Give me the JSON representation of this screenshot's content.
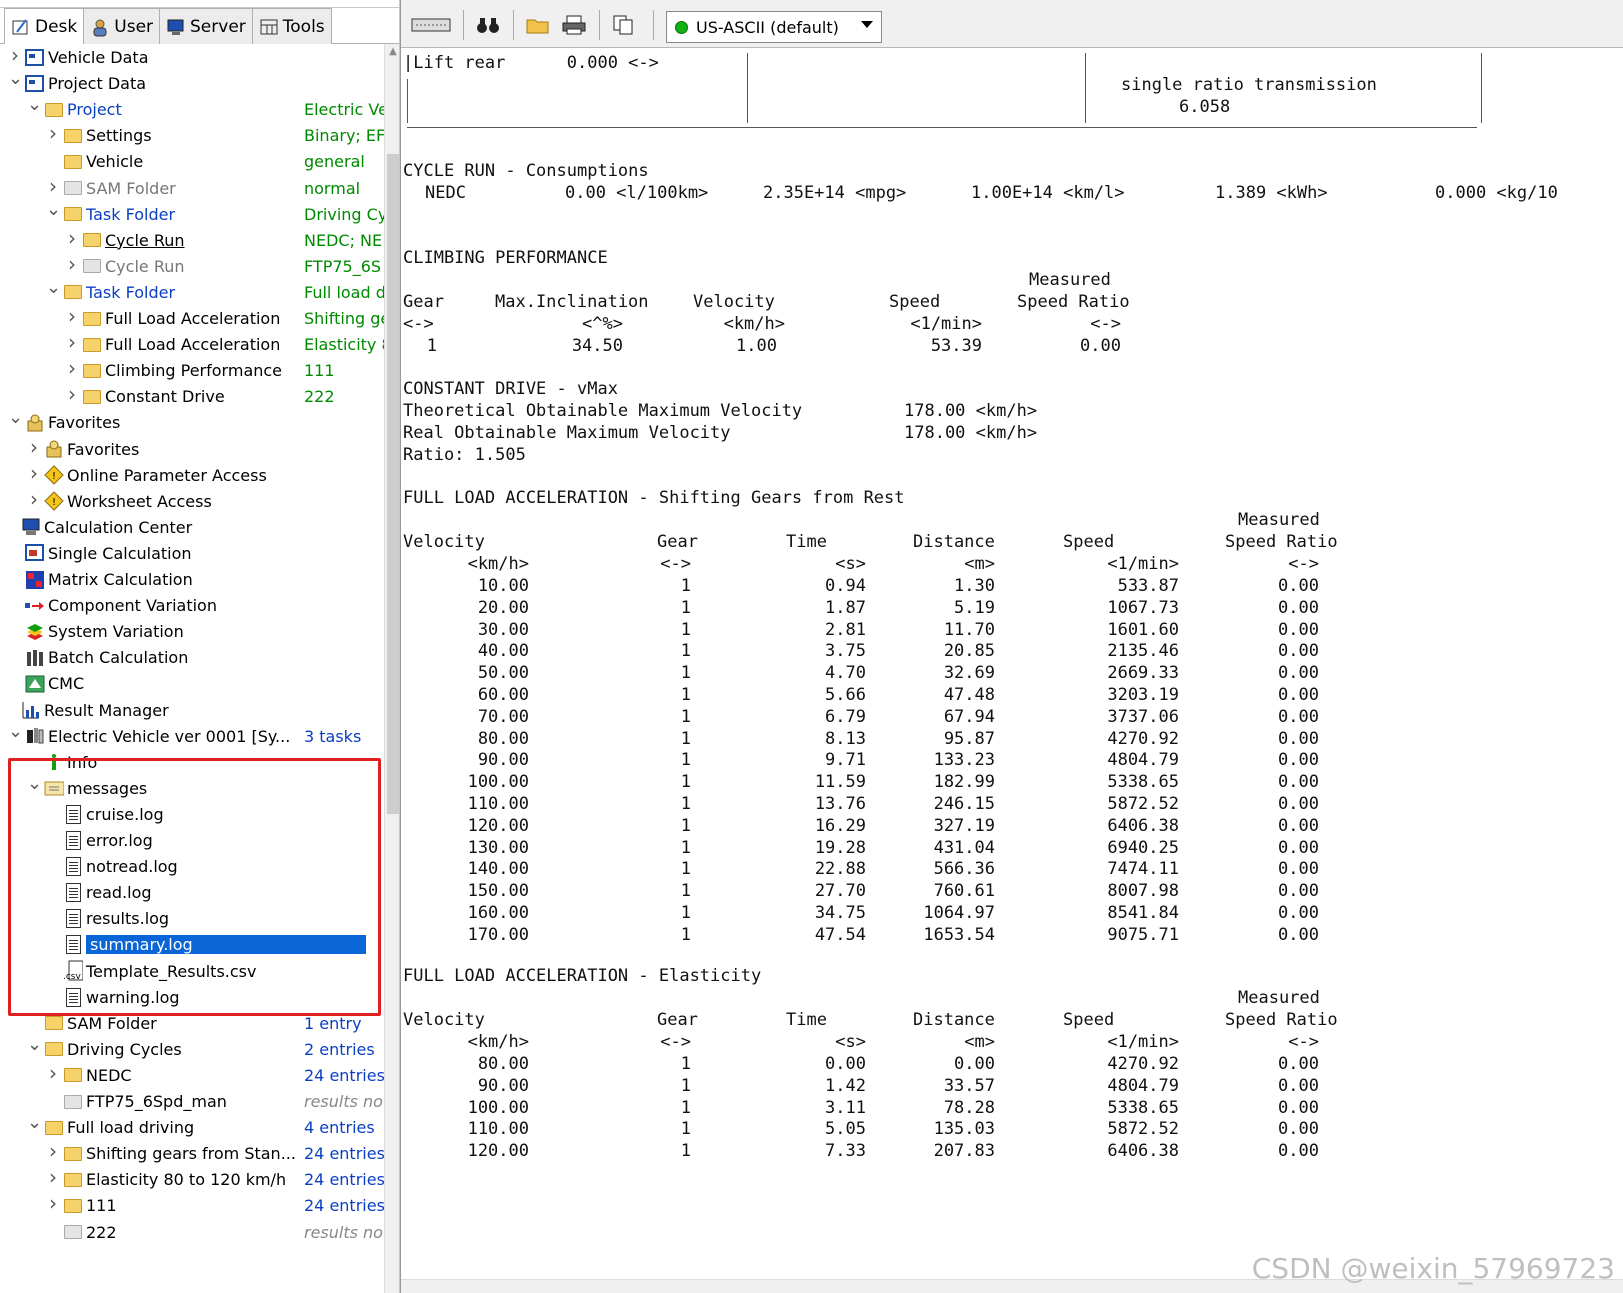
{
  "tabs": [
    "Desk",
    "User",
    "Server",
    "Tools"
  ],
  "tree": [
    {
      "label": "Vehicle Data",
      "value": ""
    },
    {
      "label": "Project Data",
      "value": ""
    },
    {
      "label": "Project",
      "value": "Electric Vel"
    },
    {
      "label": "Settings",
      "value": "Binary; EF"
    },
    {
      "label": "Vehicle",
      "value": "general"
    },
    {
      "label": "SAM Folder",
      "value": "normal"
    },
    {
      "label": "Task Folder",
      "value": "Driving Cy"
    },
    {
      "label": "Cycle Run",
      "value": "NEDC; NE"
    },
    {
      "label": "Cycle Run",
      "value": "FTP75_6S"
    },
    {
      "label": "Task Folder",
      "value": "Full load dr"
    },
    {
      "label": "Full Load Acceleration",
      "value": "Shifting ge"
    },
    {
      "label": "Full Load Acceleration",
      "value": "Elasticity 8"
    },
    {
      "label": "Climbing Performance",
      "value": "111"
    },
    {
      "label": "Constant Drive",
      "value": "222"
    },
    {
      "label": "Favorites",
      "value": ""
    },
    {
      "label": "Favorites",
      "value": ""
    },
    {
      "label": "Online Parameter Access",
      "value": ""
    },
    {
      "label": "Worksheet Access",
      "value": ""
    },
    {
      "label": "Calculation Center",
      "value": ""
    },
    {
      "label": "Single Calculation",
      "value": ""
    },
    {
      "label": "Matrix Calculation",
      "value": ""
    },
    {
      "label": "Component Variation",
      "value": ""
    },
    {
      "label": "System Variation",
      "value": ""
    },
    {
      "label": "Batch Calculation",
      "value": ""
    },
    {
      "label": "CMC",
      "value": ""
    },
    {
      "label": "Result Manager",
      "value": ""
    },
    {
      "label": "Electric Vehicle ver 0001 [Sy...",
      "value": "3 tasks"
    },
    {
      "label": "Info",
      "value": ""
    },
    {
      "label": "messages",
      "value": ""
    },
    {
      "label": "cruise.log",
      "value": ""
    },
    {
      "label": "error.log",
      "value": ""
    },
    {
      "label": "notread.log",
      "value": ""
    },
    {
      "label": "read.log",
      "value": ""
    },
    {
      "label": "results.log",
      "value": ""
    },
    {
      "label": "summary.log",
      "value": ""
    },
    {
      "label": "Template_Results.csv",
      "value": ""
    },
    {
      "label": "warning.log",
      "value": ""
    },
    {
      "label": "SAM Folder",
      "value": "1 entry"
    },
    {
      "label": "Driving Cycles",
      "value": "2 entries"
    },
    {
      "label": "NEDC",
      "value": "24 entries"
    },
    {
      "label": "FTP75_6Spd_man",
      "value": "results not"
    },
    {
      "label": "Full load driving",
      "value": "4 entries"
    },
    {
      "label": "Shifting gears from Stan...",
      "value": "24 entries"
    },
    {
      "label": "Elasticity 80 to 120 km/h",
      "value": "24 entries"
    },
    {
      "label": "111",
      "value": "24 entries"
    },
    {
      "label": "222",
      "value": "results not"
    }
  ],
  "toolbar": {
    "encoding": "US-ASCII (default)"
  },
  "report": {
    "header_box": {
      "lift_rear": "|Lift rear      0.000 <->",
      "transmission": "single ratio transmission",
      "ratio": "6.058"
    },
    "cycle_run": {
      "title": "CYCLE RUN - Consumptions",
      "cycle": "NEDC",
      "v1": "0.00 <l/100km>",
      "v2": "2.35E+14 <mpg>",
      "v3": "1.00E+14 <km/l>",
      "v4": "1.389 <kWh>",
      "v5": "0.000 <kg/10"
    },
    "climbing": {
      "title": "CLIMBING PERFORMANCE",
      "measured": "Measured",
      "headers": [
        "Gear",
        "Max.Inclination",
        "Velocity",
        "Speed",
        "Speed Ratio"
      ],
      "units": [
        "<->",
        "<^%>",
        "<km/h>",
        "<1/min>",
        "<->"
      ],
      "row": [
        "1",
        "34.50",
        "1.00",
        "53.39",
        "0.00"
      ]
    },
    "constant": {
      "title": "CONSTANT DRIVE - vMax",
      "line1_label": "Theoretical Obtainable Maximum Velocity",
      "line1_value": "178.00 <km/h>",
      "line2_label": "Real Obtainable Maximum Velocity",
      "line2_value": "178.00 <km/h>",
      "ratio": "Ratio: 1.505"
    },
    "fla1": {
      "title": "FULL LOAD ACCELERATION - Shifting Gears from Rest",
      "measured": "Measured",
      "headers": [
        "Velocity",
        "Gear",
        "Time",
        "Distance",
        "Speed",
        "Speed Ratio"
      ],
      "units": [
        "<km/h>",
        "<->",
        "<s>",
        "<m>",
        "<1/min>",
        "<->"
      ],
      "rows": [
        [
          "10.00",
          "1",
          "0.94",
          "1.30",
          "533.87",
          "0.00"
        ],
        [
          "20.00",
          "1",
          "1.87",
          "5.19",
          "1067.73",
          "0.00"
        ],
        [
          "30.00",
          "1",
          "2.81",
          "11.70",
          "1601.60",
          "0.00"
        ],
        [
          "40.00",
          "1",
          "3.75",
          "20.85",
          "2135.46",
          "0.00"
        ],
        [
          "50.00",
          "1",
          "4.70",
          "32.69",
          "2669.33",
          "0.00"
        ],
        [
          "60.00",
          "1",
          "5.66",
          "47.48",
          "3203.19",
          "0.00"
        ],
        [
          "70.00",
          "1",
          "6.79",
          "67.94",
          "3737.06",
          "0.00"
        ],
        [
          "80.00",
          "1",
          "8.13",
          "95.87",
          "4270.92",
          "0.00"
        ],
        [
          "90.00",
          "1",
          "9.71",
          "133.23",
          "4804.79",
          "0.00"
        ],
        [
          "100.00",
          "1",
          "11.59",
          "182.99",
          "5338.65",
          "0.00"
        ],
        [
          "110.00",
          "1",
          "13.76",
          "246.15",
          "5872.52",
          "0.00"
        ],
        [
          "120.00",
          "1",
          "16.29",
          "327.19",
          "6406.38",
          "0.00"
        ],
        [
          "130.00",
          "1",
          "19.28",
          "431.04",
          "6940.25",
          "0.00"
        ],
        [
          "140.00",
          "1",
          "22.88",
          "566.36",
          "7474.11",
          "0.00"
        ],
        [
          "150.00",
          "1",
          "27.70",
          "760.61",
          "8007.98",
          "0.00"
        ],
        [
          "160.00",
          "1",
          "34.75",
          "1064.97",
          "8541.84",
          "0.00"
        ],
        [
          "170.00",
          "1",
          "47.54",
          "1653.54",
          "9075.71",
          "0.00"
        ]
      ]
    },
    "fla2": {
      "title": "FULL LOAD ACCELERATION - Elasticity",
      "measured": "Measured",
      "headers": [
        "Velocity",
        "Gear",
        "Time",
        "Distance",
        "Speed",
        "Speed Ratio"
      ],
      "units": [
        "<km/h>",
        "<->",
        "<s>",
        "<m>",
        "<1/min>",
        "<->"
      ],
      "rows": [
        [
          "80.00",
          "1",
          "0.00",
          "0.00",
          "4270.92",
          "0.00"
        ],
        [
          "90.00",
          "1",
          "1.42",
          "33.57",
          "4804.79",
          "0.00"
        ],
        [
          "100.00",
          "1",
          "3.11",
          "78.28",
          "5338.65",
          "0.00"
        ],
        [
          "110.00",
          "1",
          "5.05",
          "135.03",
          "5872.52",
          "0.00"
        ],
        [
          "120.00",
          "1",
          "7.33",
          "207.83",
          "6406.38",
          "0.00"
        ]
      ]
    }
  },
  "watermark": "CSDN @weixin_57969723"
}
